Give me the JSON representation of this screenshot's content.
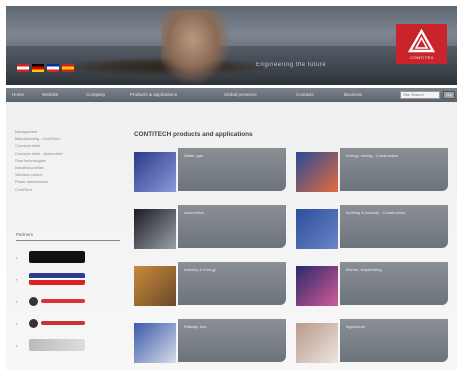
{
  "header": {
    "slogan": "Engineering the future",
    "logo_text": "CONTITEX",
    "accent": "#c9242b",
    "flags": [
      {
        "name": "flag-icon-a",
        "colors": [
          "#c22",
          "#fff",
          "#c22"
        ]
      },
      {
        "name": "flag-icon-b",
        "colors": [
          "#000",
          "#d00",
          "#fc0"
        ]
      },
      {
        "name": "flag-icon-c",
        "colors": [
          "#039",
          "#fff",
          "#d22"
        ]
      },
      {
        "name": "flag-icon-d",
        "colors": [
          "#c22",
          "#fc0",
          "#c22"
        ]
      }
    ]
  },
  "nav": {
    "items": [
      "Home",
      "Website",
      "Company",
      "Products & applications",
      "Global presence",
      "Contacts",
      "Business"
    ],
    "search_placeholder": "Site Search",
    "go_label": "Go"
  },
  "sidebar": {
    "items": [
      "Management",
      "Manufacturing - ContiTech...",
      "Conveyor belts",
      "Conveyor belts - Automotive",
      "Fluid technologies",
      "Industrial profiles",
      "Vibration control",
      "Power transmission",
      "ContiTech"
    ],
    "partners_heading": "Partners",
    "partners": [
      {
        "name": "partner-logo-black",
        "color": "#111"
      },
      {
        "name": "partner-logo-flag",
        "color": "#2a3d8f"
      },
      {
        "name": "partner-logo-red-1",
        "color": "#d33"
      },
      {
        "name": "partner-logo-red-2",
        "color": "#c33"
      },
      {
        "name": "partner-logo-grey",
        "color": "#aaa"
      }
    ]
  },
  "main": {
    "title": "CONTITECH products and applications",
    "cards": [
      {
        "label": "Water, gas",
        "thumb": [
          "#2c3a8a",
          "#8a9ad8"
        ]
      },
      {
        "label": "Energy, mining - Construction",
        "thumb": [
          "#274a9a",
          "#e46a3a"
        ]
      },
      {
        "label": "Automotive",
        "thumb": [
          "#1b1b22",
          "#9aa0aa"
        ]
      },
      {
        "label": "Building & industry - Construction",
        "thumb": [
          "#2b4f9a",
          "#6b84c8"
        ]
      },
      {
        "label": "Industry & Energy",
        "thumb": [
          "#c98a3a",
          "#6a4a2a"
        ]
      },
      {
        "label": "Marine, shipbuilding",
        "thumb": [
          "#2a2a6a",
          "#d25a9a"
        ]
      },
      {
        "label": "Railway, bus",
        "thumb": [
          "#3a5aaa",
          "#d8dce8"
        ]
      },
      {
        "label": "Agriculture",
        "thumb": [
          "#b89a8a",
          "#ece4de"
        ]
      }
    ]
  }
}
